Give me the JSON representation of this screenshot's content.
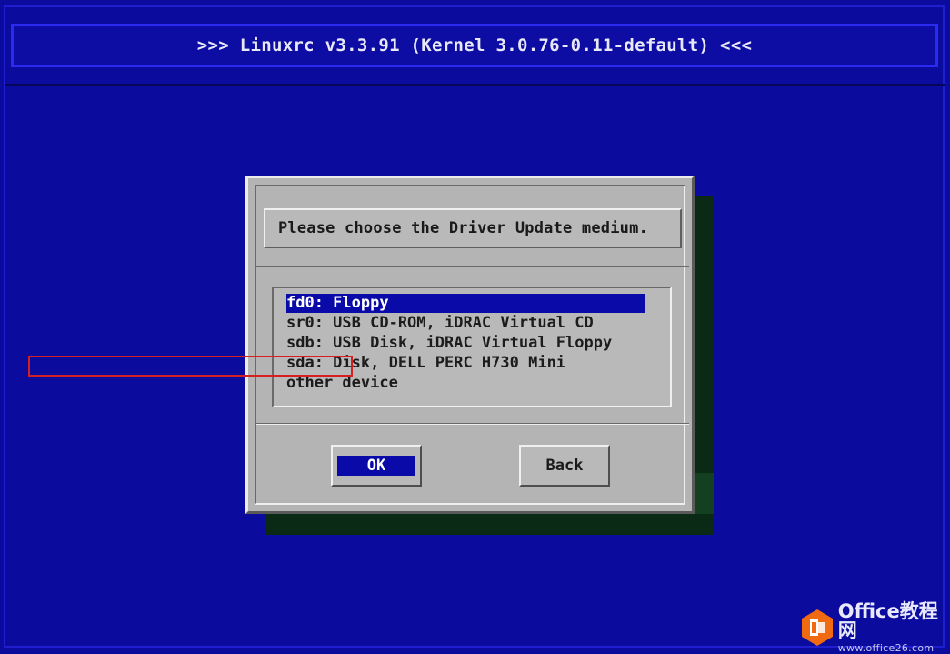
{
  "header": {
    "title": ">>> Linuxrc v3.3.91 (Kernel 3.0.76-0.11-default) <<<"
  },
  "dialog": {
    "prompt": "Please choose the Driver Update medium.",
    "devices": [
      {
        "label": "fd0: Floppy",
        "selected": true
      },
      {
        "label": "sr0: USB CD-ROM, iDRAC Virtual CD",
        "selected": false
      },
      {
        "label": "sdb: USB Disk, iDRAC Virtual Floppy",
        "selected": false
      },
      {
        "label": "sda: Disk, DELL PERC H730 Mini",
        "selected": false,
        "annotated": true
      },
      {
        "label": "other device",
        "selected": false
      }
    ],
    "buttons": {
      "ok": "OK",
      "back": "Back"
    }
  },
  "watermark": {
    "title": "Office教程网",
    "url": "www.office26.com"
  },
  "colors": {
    "background": "#0b0b9e",
    "selection": "#0a0aa8",
    "dialog": "#b4b4b4",
    "annotation": "#d42020",
    "logo": "#ef6a10"
  }
}
